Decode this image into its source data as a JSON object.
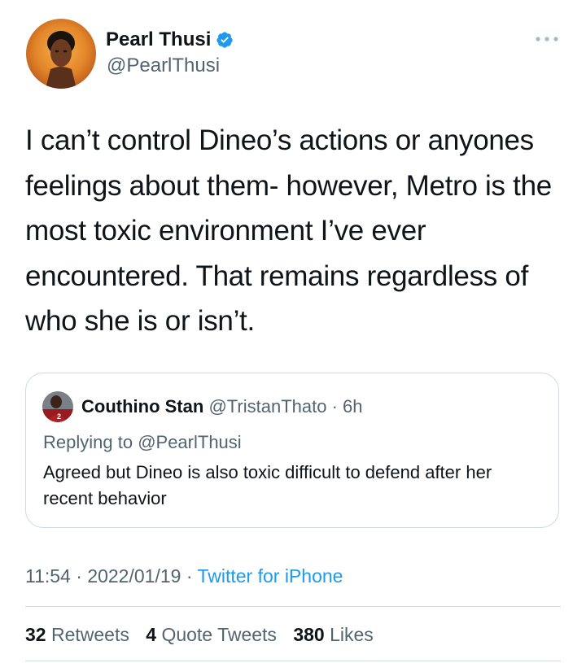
{
  "author": {
    "name": "Pearl Thusi",
    "handle": "@PearlThusi",
    "verified_color": "#1d9bf0"
  },
  "tweet": {
    "text": "I can’t control Dineo’s actions or anyones feelings about them- however, Metro is the most toxic environment I’ve ever encountered. That remains regardless of who she is or isn’t."
  },
  "quote": {
    "name": "Couthino Stan",
    "handle": "@TristanThato",
    "separator": " · ",
    "time": "6h",
    "replying_prefix": "Replying to ",
    "replying_to": "@PearlThusi",
    "text": "Agreed but Dineo is also toxic difficult to defend after her recent behavior"
  },
  "meta": {
    "time": "11:54",
    "sep1": " · ",
    "date": "2022/01/19",
    "sep2": " · ",
    "source": "Twitter for iPhone"
  },
  "stats": {
    "retweets_count": "32",
    "retweets_label": "Retweets",
    "quotes_count": "4",
    "quotes_label": "Quote Tweets",
    "likes_count": "380",
    "likes_label": "Likes"
  },
  "icons": {
    "more": "more-horizontal-icon",
    "verified": "verified-badge-icon"
  },
  "colors": {
    "accent": "#1d9bf0",
    "secondary_text": "#536471",
    "border": "#cfd9de"
  }
}
